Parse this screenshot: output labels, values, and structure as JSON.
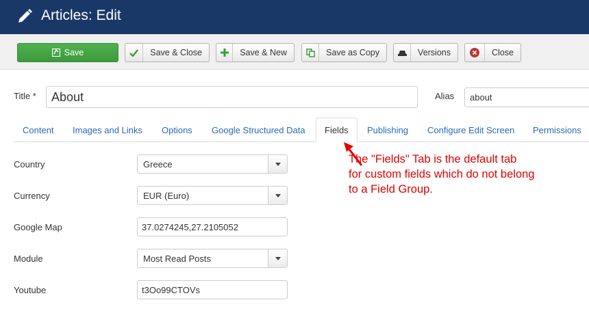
{
  "header": {
    "title": "Articles: Edit",
    "icon": "pencil-icon"
  },
  "toolbar": {
    "save": {
      "label": "Save",
      "icon": "save-icon"
    },
    "save_close": {
      "label": "Save & Close",
      "icon": "check-icon"
    },
    "save_new": {
      "label": "Save & New",
      "icon": "plus-icon"
    },
    "save_copy": {
      "label": "Save as Copy",
      "icon": "copy-icon"
    },
    "versions": {
      "label": "Versions",
      "icon": "archive-icon"
    },
    "close": {
      "label": "Close",
      "icon": "close-circle-icon"
    }
  },
  "form": {
    "title_label": "Title *",
    "title_value": "About",
    "alias_label": "Alias",
    "alias_value": "about"
  },
  "tabs": [
    {
      "label": "Content"
    },
    {
      "label": "Images and Links"
    },
    {
      "label": "Options"
    },
    {
      "label": "Google Structured Data"
    },
    {
      "label": "Fields",
      "active": true
    },
    {
      "label": "Publishing"
    },
    {
      "label": "Configure Edit Screen"
    },
    {
      "label": "Permissions"
    }
  ],
  "fields": [
    {
      "label": "Country",
      "type": "select",
      "value": "Greece"
    },
    {
      "label": "Currency",
      "type": "select",
      "value": "EUR (Euro)"
    },
    {
      "label": "Google Map",
      "type": "text",
      "value": "37.0274245,27.2105052"
    },
    {
      "label": "Module",
      "type": "select",
      "value": "Most Read Posts"
    },
    {
      "label": "Youtube",
      "type": "text",
      "value": "t3Oo99CTOVs"
    }
  ],
  "annotation": {
    "line1": "The \"Fields\" Tab is the default tab",
    "line2": "for custom fields which do not belong",
    "line3": "to a Field Group."
  },
  "colors": {
    "header_bg": "#1a3867",
    "save_green": "#46a546",
    "link_blue": "#2a69b8",
    "annotation_red": "#e00000"
  }
}
